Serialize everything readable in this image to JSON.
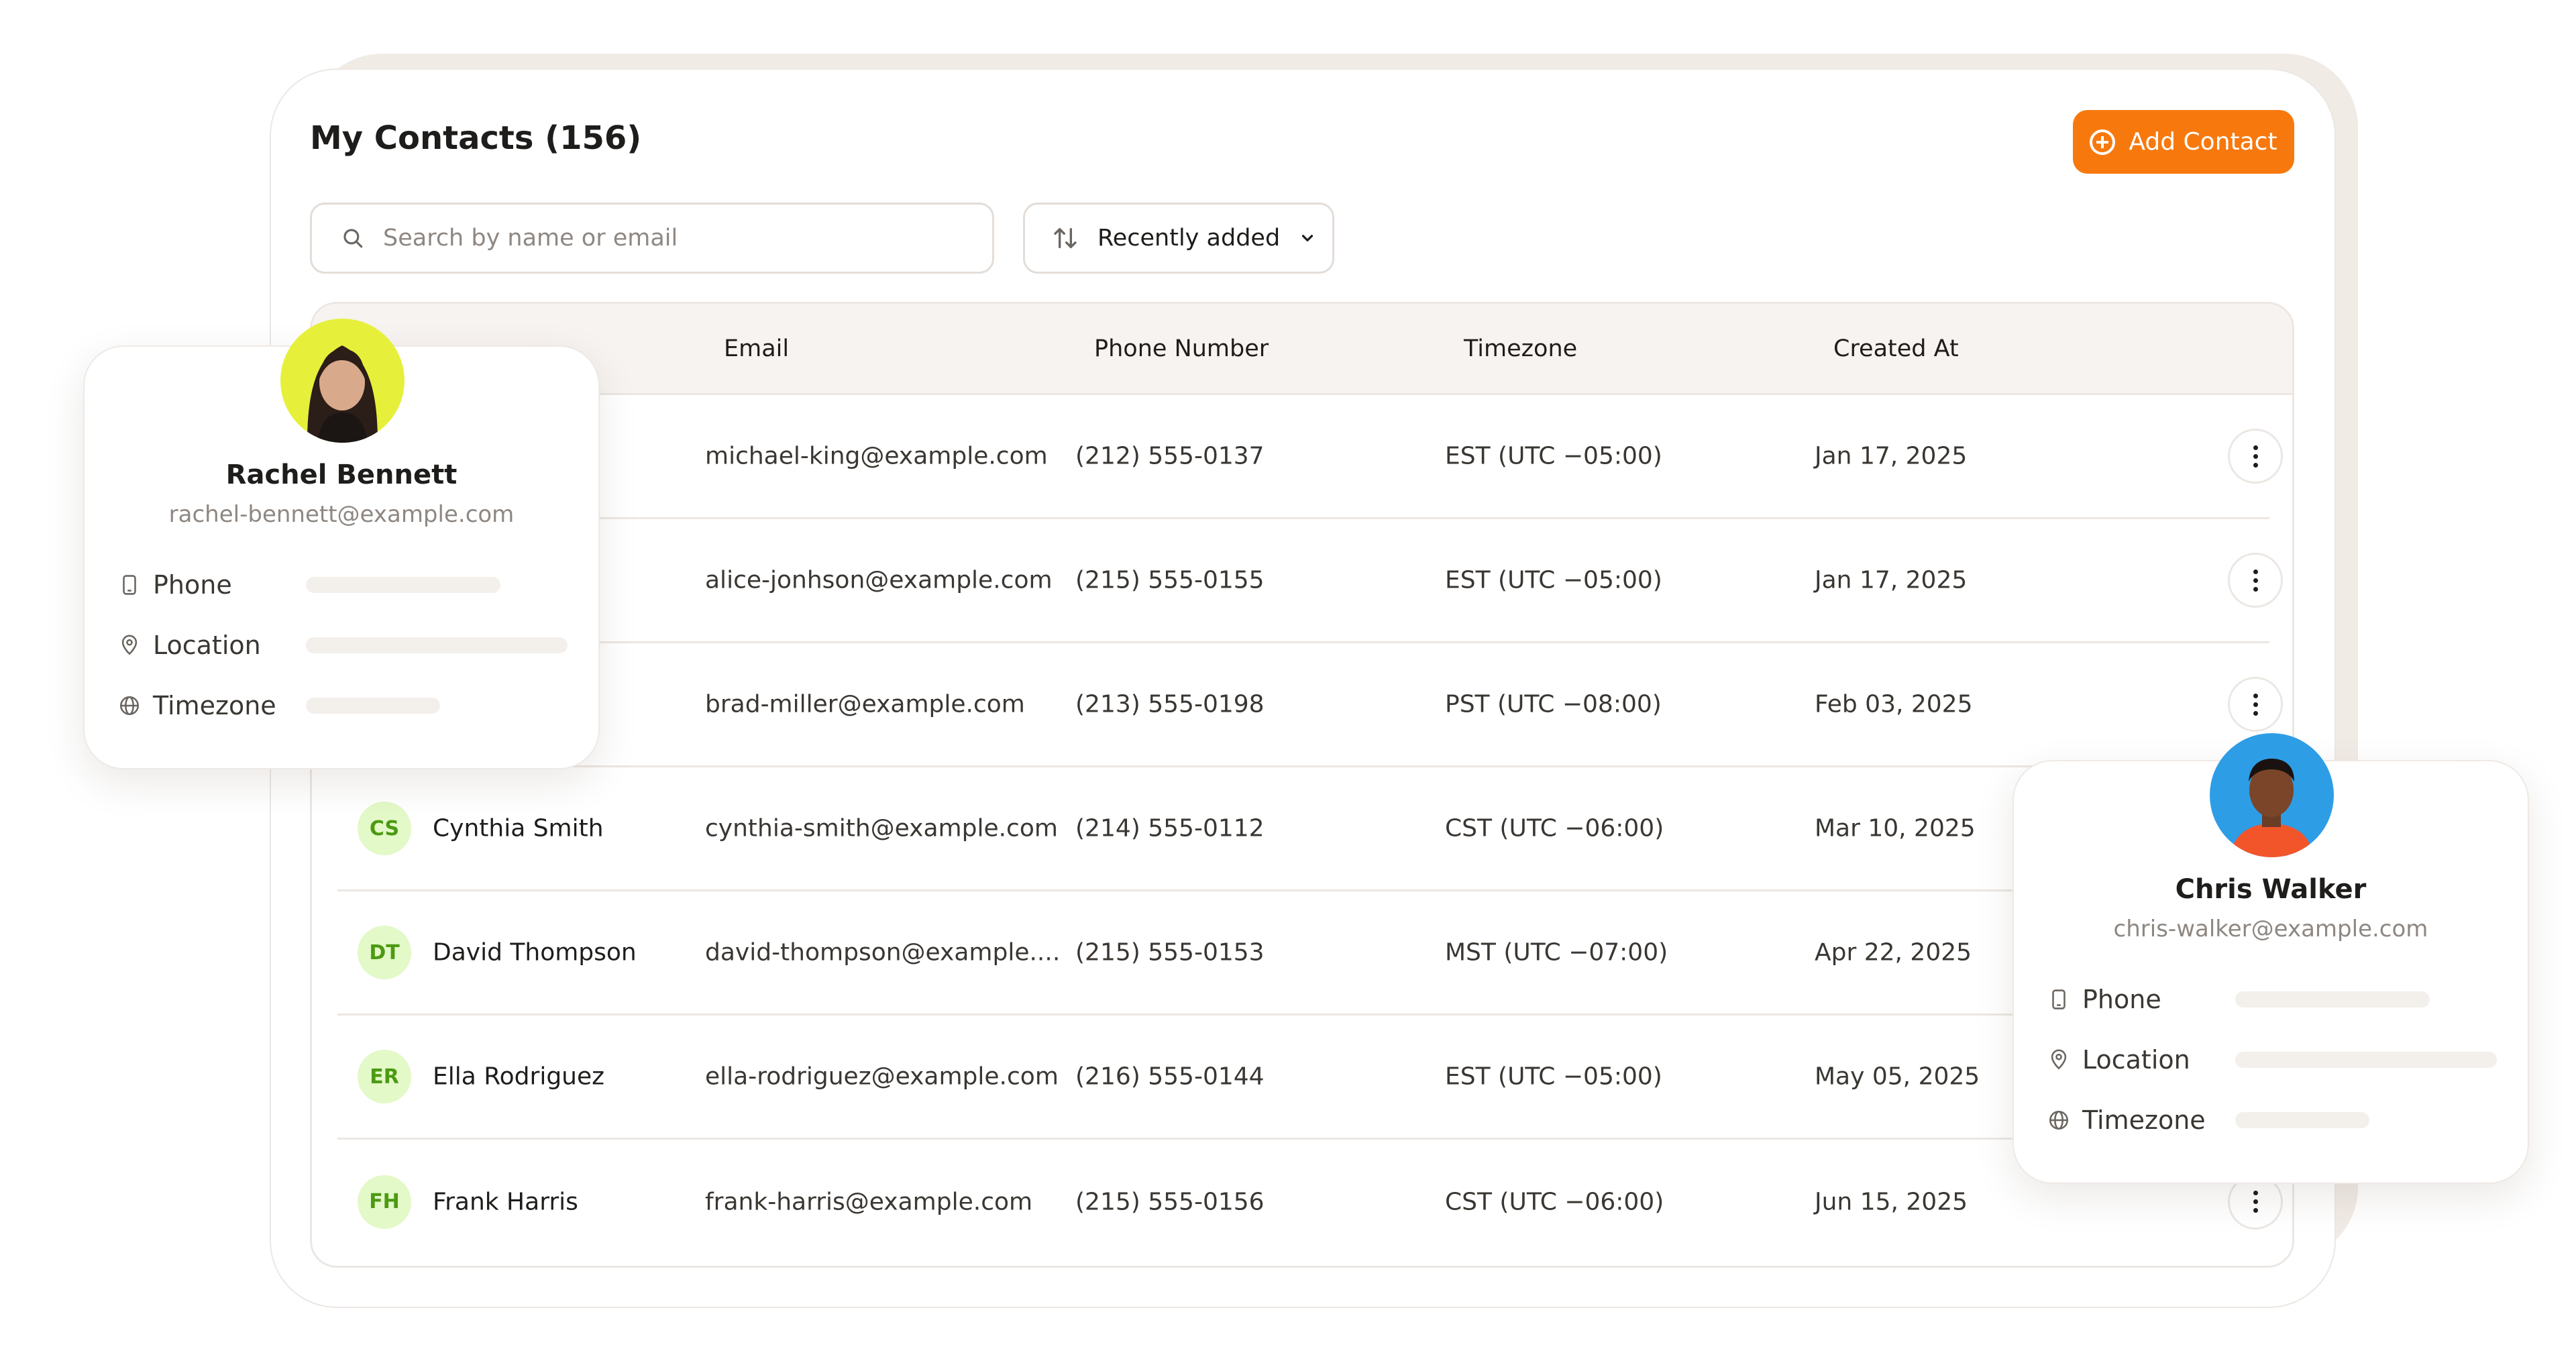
{
  "header": {
    "title": "My Contacts (156)",
    "add_button_label": "Add Contact"
  },
  "toolbar": {
    "search_placeholder": "Search by name or email",
    "sort_label": "Recently added"
  },
  "table": {
    "columns": {
      "email": "Email",
      "phone": "Phone Number",
      "timezone": "Timezone",
      "created": "Created At"
    },
    "rows": [
      {
        "initials": "",
        "name": "",
        "email": "michael-king@example.com",
        "phone": "(212) 555-0137",
        "timezone": "EST (UTC −05:00)",
        "created": "Jan 17, 2025"
      },
      {
        "initials": "",
        "name": "",
        "email": "alice-jonhson@example.com",
        "phone": "(215) 555-0155",
        "timezone": "EST (UTC −05:00)",
        "created": "Jan 17, 2025"
      },
      {
        "initials": "",
        "name": "",
        "email": "brad-miller@example.com",
        "phone": "(213) 555-0198",
        "timezone": "PST (UTC −08:00)",
        "created": "Feb 03, 2025"
      },
      {
        "initials": "CS",
        "name": "Cynthia Smith",
        "email": "cynthia-smith@example.com",
        "phone": "(214) 555-0112",
        "timezone": "CST (UTC −06:00)",
        "created": "Mar 10, 2025"
      },
      {
        "initials": "DT",
        "name": "David Thompson",
        "email": "david-thompson@example....",
        "phone": "(215) 555-0153",
        "timezone": "MST (UTC −07:00)",
        "created": "Apr 22, 2025"
      },
      {
        "initials": "ER",
        "name": "Ella Rodriguez",
        "email": "ella-rodriguez@example.com",
        "phone": "(216) 555-0144",
        "timezone": "EST (UTC −05:00)",
        "created": "May 05, 2025"
      },
      {
        "initials": "FH",
        "name": "Frank Harris",
        "email": "frank-harris@example.com",
        "phone": "(215) 555-0156",
        "timezone": "CST (UTC −06:00)",
        "created": "Jun 15, 2025"
      }
    ]
  },
  "profile_cards": [
    {
      "name": "Rachel Bennett",
      "email": "rachel-bennett@example.com",
      "fields": [
        "Phone",
        "Location",
        "Timezone"
      ]
    },
    {
      "name": "Chris Walker",
      "email": "chris-walker@example.com",
      "fields": [
        "Phone",
        "Location",
        "Timezone"
      ]
    }
  ],
  "colors": {
    "accent": "#f7790e",
    "avatar_bg": "#e3f9c8",
    "avatar_text": "#4c9a13",
    "header_bg": "#f7f3f0",
    "border": "#ece7e3"
  },
  "icons": {
    "search": "search-icon",
    "sort": "sort-arrows-icon",
    "chevron": "chevron-down-icon",
    "add": "plus-circle-icon",
    "menu": "more-vertical-icon",
    "phone": "phone-icon",
    "location": "map-pin-icon",
    "timezone": "globe-icon"
  }
}
